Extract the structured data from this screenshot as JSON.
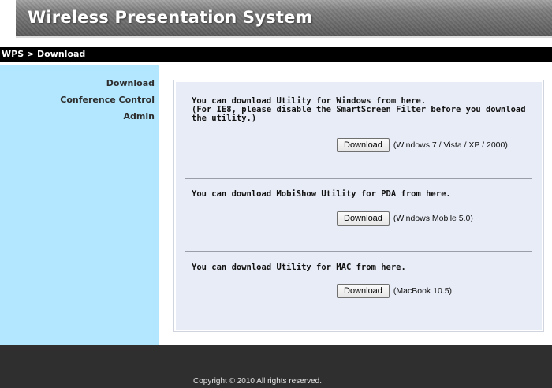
{
  "header": {
    "title": "Wireless Presentation System"
  },
  "breadcrumb": "WPS > Download",
  "sidebar": {
    "items": [
      {
        "label": "Download"
      },
      {
        "label": "Conference Control"
      },
      {
        "label": "Admin"
      }
    ]
  },
  "sections": [
    {
      "text": "You can download Utility for Windows from here.\n(For IE8, please disable the SmartScreen Filter before you download\nthe utility.)",
      "button": "Download",
      "note": "(Windows 7 / Vista / XP / 2000)"
    },
    {
      "text": "You can download MobiShow Utility for PDA from here.",
      "button": "Download",
      "note": "(Windows Mobile 5.0)"
    },
    {
      "text": "You can download Utility for MAC from here.",
      "button": "Download",
      "note": "(MacBook 10.5)"
    }
  ],
  "footer": {
    "copyright": "Copyright © 2010 All rights reserved."
  }
}
